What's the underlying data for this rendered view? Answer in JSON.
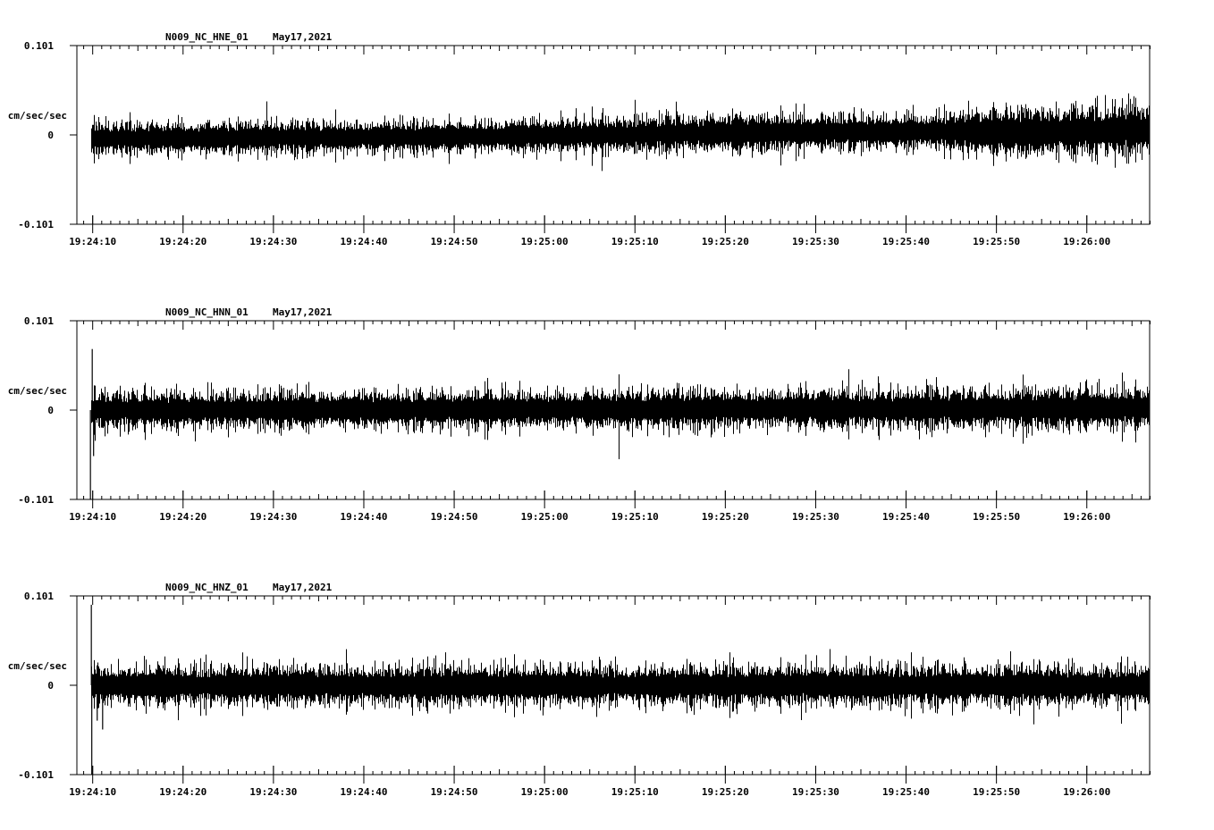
{
  "chart_data": [
    {
      "type": "line",
      "title": "N009_NC_HNE_01",
      "date": "May17,2021",
      "ylabel": "cm/sec/sec",
      "ytick_labels": [
        "0.101",
        "0",
        "-0.101"
      ],
      "ylim": [
        -0.101,
        0.101
      ],
      "xtick_labels": [
        "19:24:10",
        "19:24:20",
        "19:24:30",
        "19:24:40",
        "19:24:50",
        "19:25:00",
        "19:25:10",
        "19:25:20",
        "19:25:30",
        "19:25:40",
        "19:25:50",
        "19:26:00"
      ],
      "x_start_s": 8.3,
      "x_end_s": 127.0,
      "trace_start_s": 9.85,
      "amplitude_profile": [
        {
          "t": 10,
          "a": 0.018,
          "o": -0.004
        },
        {
          "t": 50,
          "a": 0.018,
          "o": -0.002
        },
        {
          "t": 80,
          "a": 0.02,
          "o": 0.002
        },
        {
          "t": 105,
          "a": 0.02,
          "o": 0.004
        },
        {
          "t": 110,
          "a": 0.028,
          "o": 0.003
        },
        {
          "t": 127,
          "a": 0.026,
          "o": 0.006
        }
      ],
      "spikes": []
    },
    {
      "type": "line",
      "title": "N009_NC_HNN_01",
      "date": "May17,2021",
      "ylabel": "cm/sec/sec",
      "ytick_labels": [
        "0.101",
        "0",
        "-0.101"
      ],
      "ylim": [
        -0.101,
        0.101
      ],
      "xtick_labels": [
        "19:24:10",
        "19:24:20",
        "19:24:30",
        "19:24:40",
        "19:24:50",
        "19:25:00",
        "19:25:10",
        "19:25:20",
        "19:25:30",
        "19:25:40",
        "19:25:50",
        "19:26:00"
      ],
      "x_start_s": 8.3,
      "x_end_s": 127.0,
      "trace_start_s": 9.85,
      "amplitude_profile": [
        {
          "t": 10,
          "a": 0.02,
          "o": 0.0
        },
        {
          "t": 127,
          "a": 0.022,
          "o": 0.002
        }
      ],
      "spikes": [
        {
          "t": 9.75,
          "y": -0.101
        },
        {
          "t": 9.95,
          "y": 0.069
        },
        {
          "t": 10.1,
          "y": -0.052
        }
      ]
    },
    {
      "type": "line",
      "title": "N009_NC_HNZ_01",
      "date": "May17,2021",
      "ylabel": "cm/sec/sec",
      "ytick_labels": [
        "0.101",
        "0",
        "-0.101"
      ],
      "ylim": [
        -0.101,
        0.101
      ],
      "xtick_labels": [
        "19:24:10",
        "19:24:20",
        "19:24:30",
        "19:24:40",
        "19:24:50",
        "19:25:00",
        "19:25:10",
        "19:25:20",
        "19:25:30",
        "19:25:40",
        "19:25:50",
        "19:26:00"
      ],
      "x_start_s": 8.3,
      "x_end_s": 127.0,
      "trace_start_s": 9.85,
      "amplitude_profile": [
        {
          "t": 10,
          "a": 0.022,
          "o": 0.0
        },
        {
          "t": 127,
          "a": 0.022,
          "o": 0.0
        }
      ],
      "spikes": [
        {
          "t": 9.85,
          "y": 0.091
        },
        {
          "t": 9.9,
          "y": -0.101
        },
        {
          "t": 11.1,
          "y": -0.05
        },
        {
          "t": 10.5,
          "y": -0.04
        }
      ]
    }
  ]
}
